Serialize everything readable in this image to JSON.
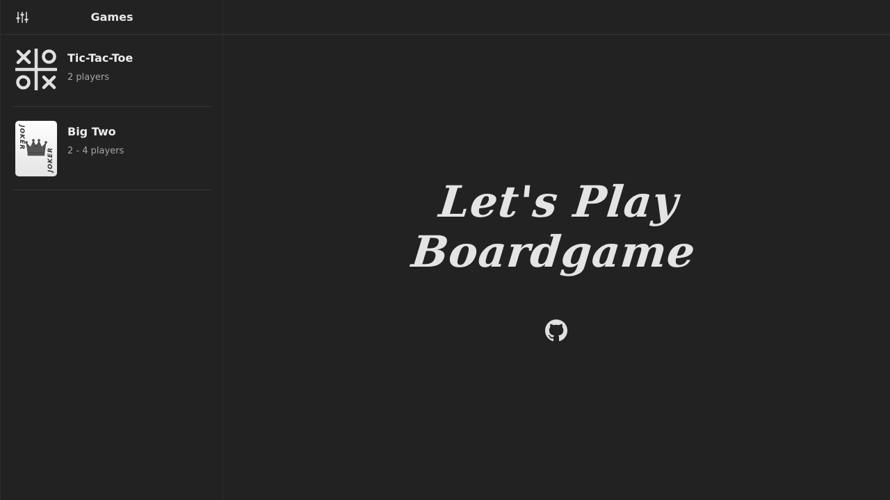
{
  "sidebar": {
    "title": "Games",
    "settings_icon": "sliders-icon",
    "games": [
      {
        "name": "Tic-Tac-Toe",
        "players": "2 players",
        "icon": "tic-tac-toe-icon"
      },
      {
        "name": "Big Two",
        "players": "2 - 4 players",
        "icon": "joker-card-icon",
        "card_text": "JOKER"
      }
    ]
  },
  "main": {
    "title_line1": "Let's Play",
    "title_line2": "Boardgame",
    "github_icon": "github-icon"
  },
  "colors": {
    "background": "#222222",
    "text": "#e6e6e6",
    "muted_text": "#a6a6a6",
    "divider": "#363636"
  }
}
